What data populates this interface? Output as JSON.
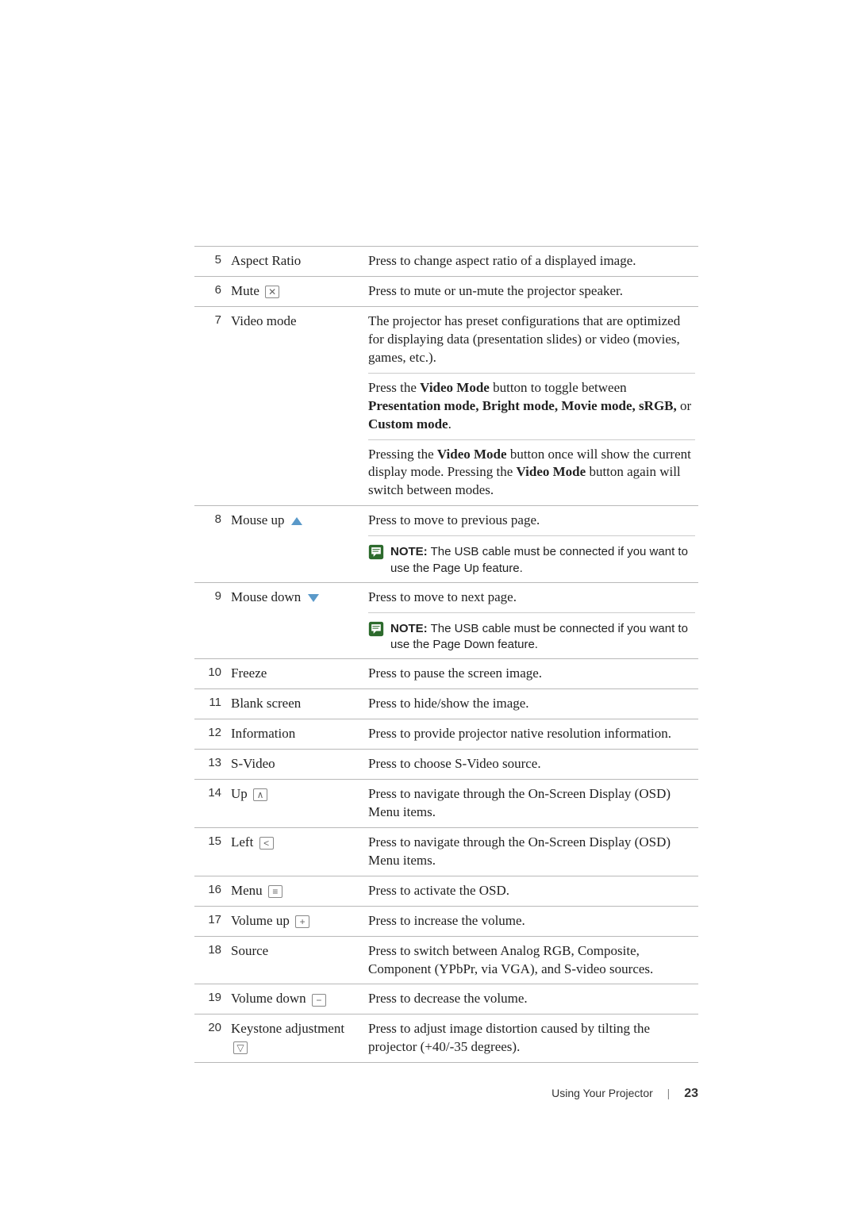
{
  "rows": [
    {
      "num": "5",
      "label": "Aspect Ratio",
      "icon": null,
      "desc": [
        {
          "type": "text",
          "html": "Press to change aspect ratio of a displayed image."
        }
      ]
    },
    {
      "num": "6",
      "label": "Mute",
      "icon": "mute",
      "desc": [
        {
          "type": "text",
          "html": "Press to mute or un-mute the projector speaker."
        }
      ]
    },
    {
      "num": "7",
      "label": "Video mode",
      "icon": null,
      "desc": [
        {
          "type": "text",
          "html": "The projector has preset configurations that are optimized for displaying data (presentation slides) or video (movies, games, etc.)."
        },
        {
          "type": "text",
          "html": "Press the <b>Video Mode</b> button to toggle between <b>Presentation mode, Bright mode, Movie mode, sRGB,</b> or <b>Custom mode</b>."
        },
        {
          "type": "text",
          "html": "Pressing the <b>Video Mode</b> button once will show the current display mode. Pressing the <b>Video Mode</b> button again will switch between modes."
        }
      ]
    },
    {
      "num": "8",
      "label": "Mouse up",
      "icon": "arrow-up",
      "desc": [
        {
          "type": "text",
          "html": "Press to move to previous page."
        },
        {
          "type": "note",
          "label": "NOTE:",
          "text": " The USB cable must be connected if you want to use the Page Up feature."
        }
      ]
    },
    {
      "num": "9",
      "label": "Mouse down",
      "icon": "arrow-down",
      "desc": [
        {
          "type": "text",
          "html": "Press to move to next page."
        },
        {
          "type": "note",
          "label": "NOTE:",
          "text": " The USB cable must be connected if you want to use the Page Down feature."
        }
      ]
    },
    {
      "num": "10",
      "label": "Freeze",
      "icon": null,
      "desc": [
        {
          "type": "text",
          "html": "Press to pause the screen image."
        }
      ]
    },
    {
      "num": "11",
      "label": "Blank screen",
      "icon": null,
      "desc": [
        {
          "type": "text",
          "html": "Press to hide/show the image."
        }
      ]
    },
    {
      "num": "12",
      "label": "Information",
      "icon": null,
      "desc": [
        {
          "type": "text",
          "html": "Press to provide projector native resolution information."
        }
      ]
    },
    {
      "num": "13",
      "label": "S-Video",
      "icon": null,
      "desc": [
        {
          "type": "text",
          "html": "Press to choose S-Video source."
        }
      ]
    },
    {
      "num": "14",
      "label": "Up",
      "icon": "nav-up",
      "desc": [
        {
          "type": "text",
          "html": "Press to navigate through the On-Screen Display (OSD) Menu items."
        }
      ]
    },
    {
      "num": "15",
      "label": "Left",
      "icon": "nav-left",
      "desc": [
        {
          "type": "text",
          "html": "Press to navigate through the On-Screen Display (OSD) Menu items."
        }
      ]
    },
    {
      "num": "16",
      "label": "Menu",
      "icon": "menu",
      "desc": [
        {
          "type": "text",
          "html": "Press to activate the OSD."
        }
      ]
    },
    {
      "num": "17",
      "label": "Volume up",
      "icon": "plus",
      "desc": [
        {
          "type": "text",
          "html": "Press to increase the volume."
        }
      ]
    },
    {
      "num": "18",
      "label": "Source",
      "icon": null,
      "desc": [
        {
          "type": "text",
          "html": "Press to switch between Analog RGB, Composite, Component (YPbPr, via VGA), and S-video sources."
        }
      ]
    },
    {
      "num": "19",
      "label": "Volume down",
      "icon": "minus",
      "desc": [
        {
          "type": "text",
          "html": "Press to decrease the volume."
        }
      ]
    },
    {
      "num": "20",
      "label": "Keystone adjustment",
      "icon": "keystone-down",
      "desc": [
        {
          "type": "text",
          "html": "Press to adjust image distortion caused by tilting the projector (+40/-35 degrees)."
        }
      ]
    }
  ],
  "footer": {
    "section": "Using Your Projector",
    "page": "23"
  }
}
